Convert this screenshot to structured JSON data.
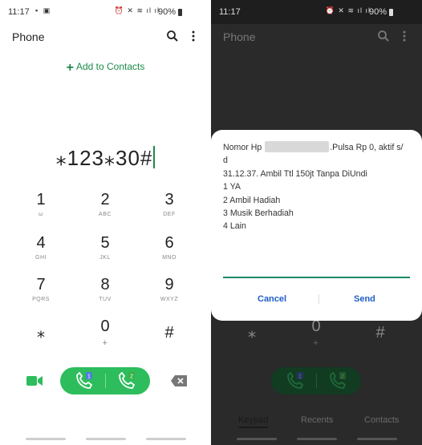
{
  "status": {
    "time": "11:17",
    "battery": "90%"
  },
  "appbar": {
    "title": "Phone"
  },
  "add_to_contacts": "Add to Contacts",
  "dialed_number": "⁎123⁎30#",
  "keypad": [
    {
      "digit": "1",
      "letters": "ω"
    },
    {
      "digit": "2",
      "letters": "ABC"
    },
    {
      "digit": "3",
      "letters": "DEF"
    },
    {
      "digit": "4",
      "letters": "GHI"
    },
    {
      "digit": "5",
      "letters": "JKL"
    },
    {
      "digit": "6",
      "letters": "MNO"
    },
    {
      "digit": "7",
      "letters": "PQRS"
    },
    {
      "digit": "8",
      "letters": "TUV"
    },
    {
      "digit": "9",
      "letters": "WXYZ"
    },
    {
      "digit": "⁎",
      "letters": ""
    },
    {
      "digit": "0",
      "letters": "+"
    },
    {
      "digit": "#",
      "letters": ""
    }
  ],
  "call": {
    "sim1": "1",
    "sim2": "2"
  },
  "ussd_dialog": {
    "lines": [
      {
        "prefix": "Nomor Hp",
        "suffix": ".Pulsa Rp 0, aktif s/"
      },
      {
        "text": "d"
      },
      {
        "text": "31.12.37. Ambil Ttl 150jt Tanpa DiUndi"
      },
      {
        "text": "1 YA"
      },
      {
        "text": "2 Ambil Hadiah"
      },
      {
        "text": "3 Musik Berhadiah"
      },
      {
        "text": "4 Lain"
      }
    ],
    "cancel_label": "Cancel",
    "send_label": "Send"
  },
  "tabs": {
    "keypad": "Keypad",
    "recents": "Recents",
    "contacts": "Contacts"
  },
  "colors": {
    "accent_green": "#2dbd5c",
    "text_green": "#1b8a4a",
    "dialog_button": "#1e5fc4"
  }
}
